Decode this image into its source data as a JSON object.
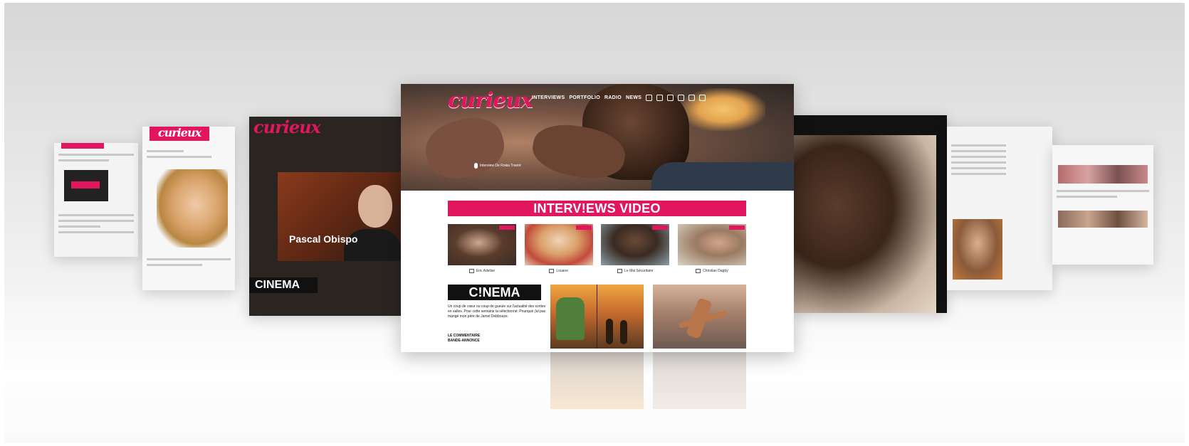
{
  "brand": {
    "logo_text": "curieux",
    "accent_color": "#e2165e"
  },
  "main_page": {
    "nav_items": [
      "INTERVIEWS",
      "PORTFOLIO",
      "RADIO",
      "NEWS"
    ],
    "social_icons": [
      "facebook-icon",
      "twitter-icon",
      "vimeo-icon",
      "google-icon",
      "youtube-icon",
      "rss-icon"
    ],
    "hero_caption": "Interview De Rokia Traoré",
    "interviews_heading": "INTERV!EWS VIDEO",
    "thumbnails": [
      {
        "label": "Eric Adelise"
      },
      {
        "label": "Louane"
      },
      {
        "label": "Le Mal Sécuritaire"
      },
      {
        "label": "Christian Dagby"
      }
    ],
    "cinema_heading": "C!NEMA",
    "cinema_text": "Un coup de cœur ou coup de gueule sur l'actualité des sorties en salles. Pour cette semaine la sélectionné: Pourquoi j'ai pas mangé mon père de Jamel Debbouze.",
    "cinema_comment": "LE COMMENTAIRE",
    "cinema_trailer": "BANDE-ANNONCE"
  },
  "left_pages": {
    "video_page_logo": "curieux",
    "video_title": "Pascal Obispo",
    "cinema_heading": "CINEMA",
    "second_logo": "curieux"
  }
}
